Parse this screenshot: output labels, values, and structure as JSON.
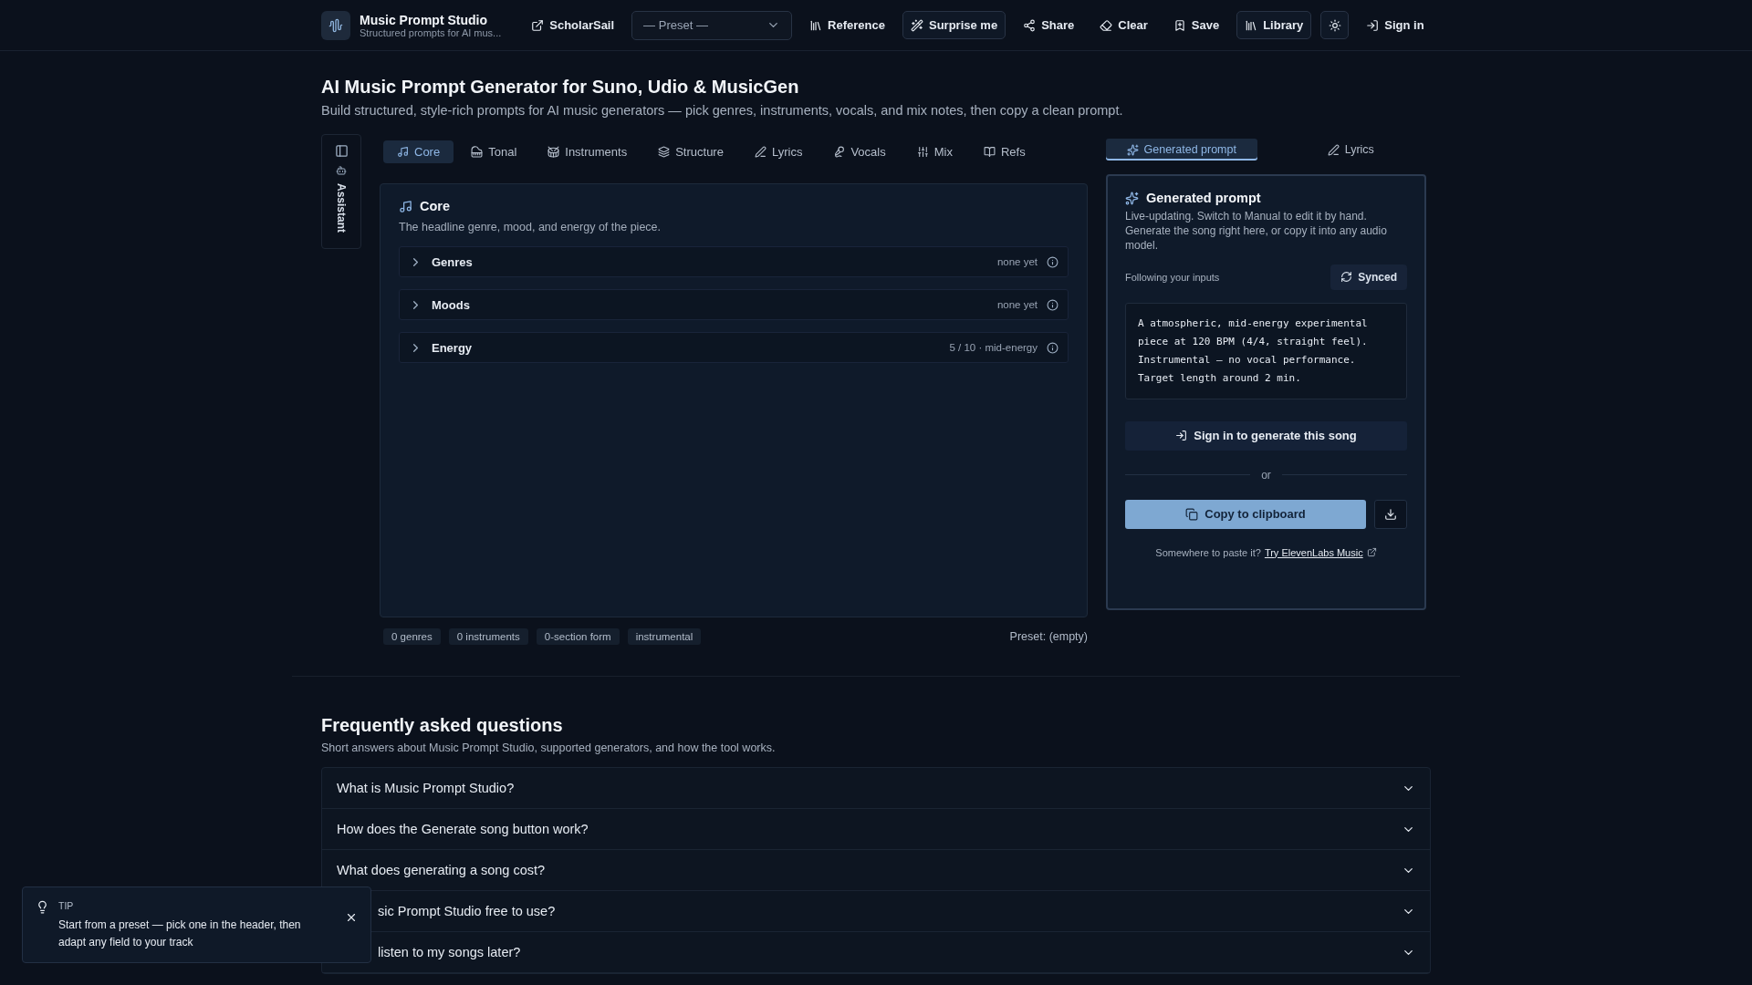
{
  "header": {
    "app_name": "Music Prompt Studio",
    "app_subtitle": "Structured prompts for AI mus...",
    "actions": [
      {
        "label": "ScholarSail",
        "kind": "link"
      },
      {
        "label": "— Preset —",
        "kind": "select"
      },
      {
        "label": "Reference",
        "kind": "plain"
      },
      {
        "label": "Surprise me",
        "kind": "outlined"
      },
      {
        "label": "Share",
        "kind": "plain"
      },
      {
        "label": "Clear",
        "kind": "plain"
      },
      {
        "label": "Save",
        "kind": "plain"
      },
      {
        "label": "Library",
        "kind": "outlined"
      },
      {
        "kind": "theme"
      },
      {
        "label": "Sign in",
        "kind": "plain"
      }
    ]
  },
  "page": {
    "title": "AI Music Prompt Generator for Suno, Udio & MusicGen",
    "subtitle": "Build structured, style-rich prompts for AI music generators — pick genres, instruments, vocals, and mix notes, then copy a clean prompt."
  },
  "assistant_rail": {
    "label": "Assistant"
  },
  "tabs": [
    {
      "label": "Core",
      "selected": true
    },
    {
      "label": "Tonal",
      "selected": false
    },
    {
      "label": "Instruments",
      "selected": false
    },
    {
      "label": "Structure",
      "selected": false
    },
    {
      "label": "Lyrics",
      "selected": false
    },
    {
      "label": "Vocals",
      "selected": false
    },
    {
      "label": "Mix",
      "selected": false
    },
    {
      "label": "Refs",
      "selected": false
    }
  ],
  "section": {
    "title": "Core",
    "description": "The headline genre, mood, and energy of the piece.",
    "rows": [
      {
        "label": "Genres",
        "value": "none yet",
        "expanded": false
      },
      {
        "label": "Moods",
        "value": "none yet",
        "expanded": false
      },
      {
        "label": "Energy",
        "value": "5 / 10 · mid-energy",
        "expanded": false
      }
    ]
  },
  "chips": [
    "0 genres",
    "0 instruments",
    "0-section form",
    "instrumental"
  ],
  "preset_status": "Preset: (empty)",
  "side_tabs": [
    {
      "label": "Generated prompt",
      "selected": true
    },
    {
      "label": "Lyrics",
      "selected": false
    }
  ],
  "prompt_panel": {
    "title": "Generated prompt",
    "description": "Live-updating. Switch to Manual to edit it by hand. Generate the song right here, or copy it into any audio model.",
    "mode_label": "Following your inputs",
    "sync_button": "Synced",
    "prompt": "A atmospheric, mid-energy experimental piece at 120 BPM (4/4, straight feel). Instrumental — no vocal performance. Target length around 2 min.",
    "generate_button": "Sign in to generate this song",
    "divider": "or",
    "copy_button": "Copy to clipboard",
    "paste_hint": "Somewhere to paste it?",
    "paste_link": "Try ElevenLabs Music"
  },
  "faq": {
    "title": "Frequently asked questions",
    "subtitle": "Short answers about Music Prompt Studio, supported generators, and how the tool works.",
    "items": [
      {
        "question": "What is Music Prompt Studio?",
        "covered": false
      },
      {
        "question": "How does the Generate song button work?",
        "covered": false
      },
      {
        "question": "What does generating a song cost?",
        "covered": false
      },
      {
        "question": "sic Prompt Studio free to use?",
        "covered": true
      },
      {
        "question": "listen to my songs later?",
        "covered": true
      }
    ]
  },
  "tip": {
    "label": "TIP",
    "text": "Start from a preset — pick one in the header, then adapt any field to your track"
  }
}
